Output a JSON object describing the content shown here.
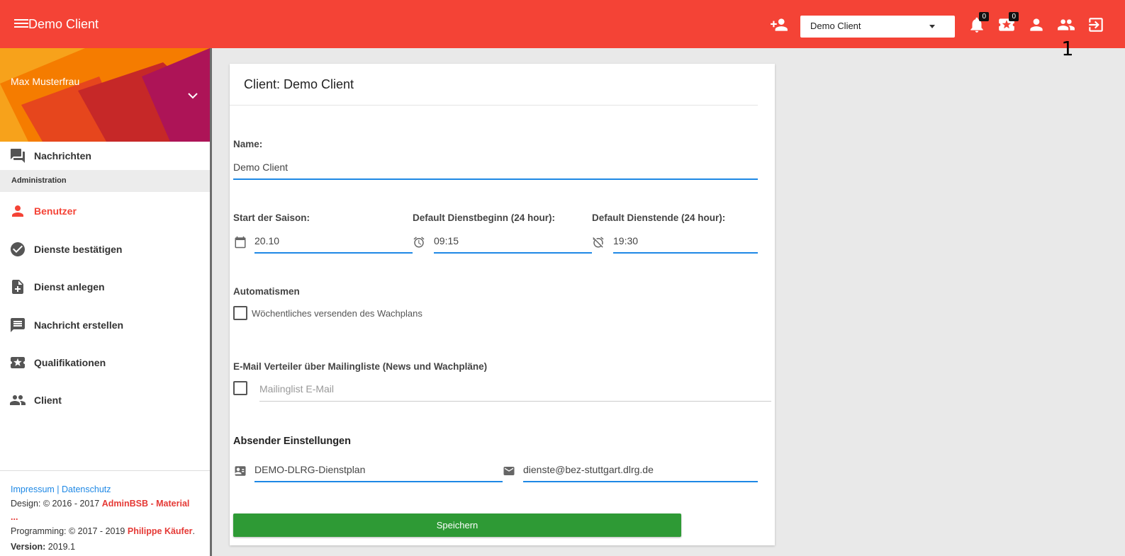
{
  "header": {
    "app_title": "Demo Client",
    "client_select_value": "Demo Client",
    "notifications_count": "0",
    "qualifications_count": "0",
    "users_count": "1",
    "accent_color": "#f44336"
  },
  "sidebar": {
    "user_name": "Max Musterfrau",
    "top_item": {
      "label": "Nachrichten",
      "icon": "forum-icon"
    },
    "section_label": "Administration",
    "items": [
      {
        "label": "Benutzer",
        "icon": "person-icon",
        "active": true
      },
      {
        "label": "Dienste bestätigen",
        "icon": "check-circle-icon"
      },
      {
        "label": "Dienst anlegen",
        "icon": "note-add-icon"
      },
      {
        "label": "Nachricht erstellen",
        "icon": "message-icon"
      },
      {
        "label": "Qualifikationen",
        "icon": "stars-ticket-icon"
      },
      {
        "label": "Client",
        "icon": "people-icon"
      }
    ],
    "footer": {
      "links": "Impressum | Datenschutz",
      "design_prefix": "Design: © 2016 - 2017 ",
      "design_name": "AdminBSB - Material ...",
      "programming_prefix": "Programming: © 2017 - 2019 ",
      "programming_name": "Philippe Käufer",
      "programming_suffix": ".",
      "version_label": "Version:",
      "version_value": " 2019.1"
    }
  },
  "form": {
    "title": "Client: Demo Client",
    "name_label": "Name:",
    "name_value": "Demo Client",
    "season_start_label": "Start der Saison:",
    "season_start_value": "20.10",
    "shift_begin_label": "Default Dienstbeginn (24 hour):",
    "shift_begin_value": "09:15",
    "shift_end_label": "Default Dienstende (24 hour):",
    "shift_end_value": "19:30",
    "automation_label": "Automatismen",
    "weekly_send_label": "Wöchentliches versenden des Wachplans",
    "weekly_send_checked": false,
    "mailing_label": "E-Mail Verteiler über Mailingliste (News und Wachpläne)",
    "mailing_checked": false,
    "mailing_placeholder": "Mailinglist E-Mail",
    "sender_title": "Absender Einstellungen",
    "sender_name_value": "DEMO-DLRG-Dienstplan",
    "sender_email_value": "dienste@bez-stuttgart.dlrg.de",
    "save_label": "Speichern",
    "save_color": "#2e9a35"
  }
}
